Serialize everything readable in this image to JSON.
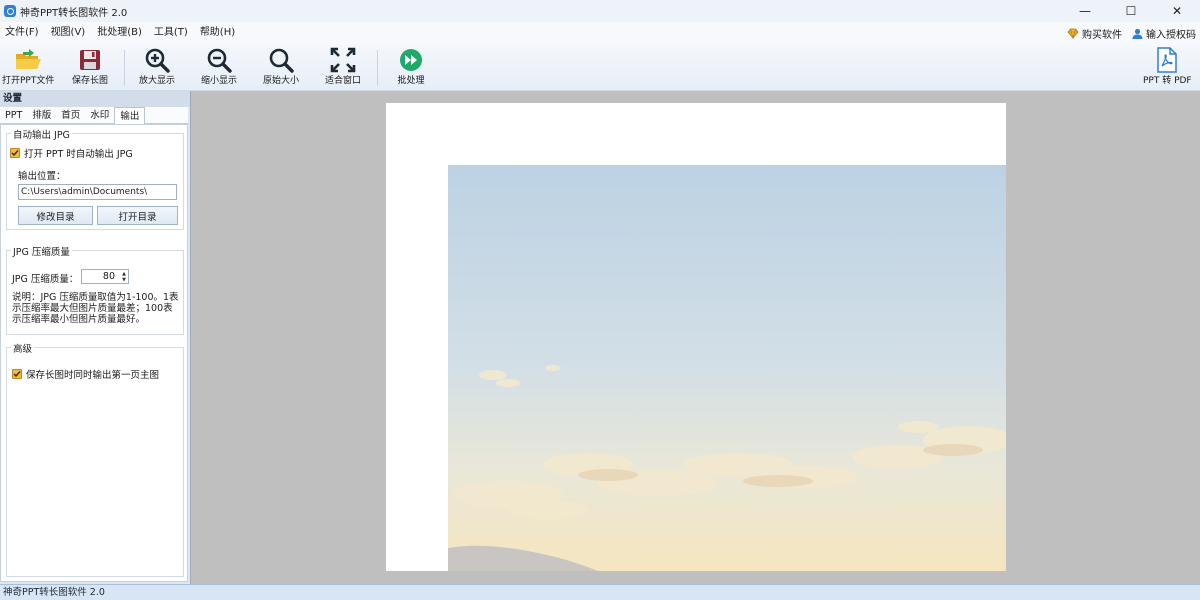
{
  "window": {
    "title": "神奇PPT转长图软件 2.0",
    "controls": {
      "minimize": "—",
      "maximize": "☐",
      "close": "✕"
    }
  },
  "menu": {
    "items": [
      "文件(F)",
      "视图(V)",
      "批处理(B)",
      "工具(T)",
      "帮助(H)"
    ],
    "buy": "购买软件",
    "license": "输入授权码"
  },
  "toolbar": {
    "open": "打开PPT文件",
    "save": "保存长图",
    "zoom_in": "放大显示",
    "zoom_out": "缩小显示",
    "actual_size": "原始大小",
    "fit_window": "适合窗口",
    "batch": "批处理",
    "ppt_to_pdf": "PPT 转 PDF"
  },
  "settings": {
    "header": "设置",
    "tabs": [
      "PPT",
      "排版",
      "首页",
      "水印",
      "输出"
    ],
    "active_tab": "输出",
    "auto_jpg": {
      "title": "自动输出 JPG",
      "checkbox_label": "打开 PPT 时自动输出 JPG",
      "checked": true,
      "location_label": "输出位置：",
      "location_value": "C:\\Users\\admin\\Documents\\",
      "change_dir": "修改目录",
      "open_dir": "打开目录"
    },
    "quality": {
      "title": "JPG 压缩质量",
      "label": "JPG 压缩质量：",
      "value": "80",
      "note_lines": [
        "说明：JPG 压缩质量取值为1-100。1表",
        "示压缩率最大但图片质量最差；100表",
        "示压缩率最小但图片质量最好。"
      ]
    },
    "advanced": {
      "title": "高级",
      "checkbox_label": "保存长图时同时输出第一页主图",
      "checked": true
    }
  },
  "status": {
    "text": "神奇PPT转长图软件 2.0"
  },
  "colors": {
    "accent": "#2f7fd6",
    "checkbox": "#f4b940",
    "workspace": "#bfbfbf"
  }
}
